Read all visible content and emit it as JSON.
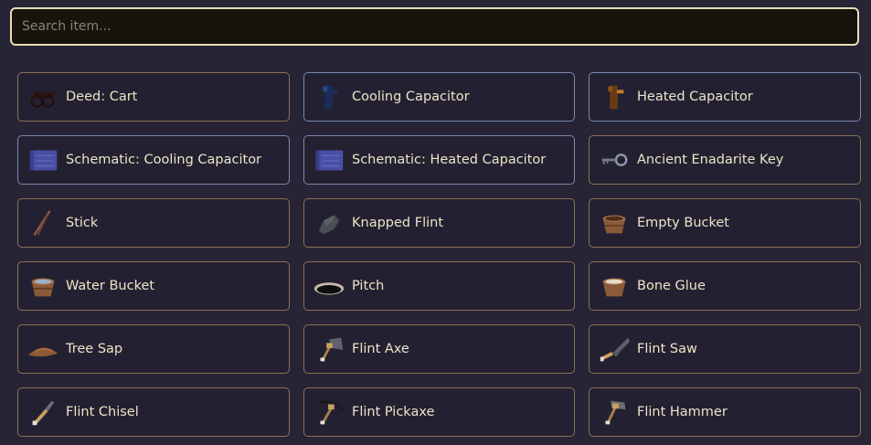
{
  "search": {
    "placeholder": "Search item...",
    "value": ""
  },
  "items": [
    {
      "label": "Deed: Cart",
      "icon": "cart-icon",
      "border": "#8a7253"
    },
    {
      "label": "Cooling Capacitor",
      "icon": "cooling-capacitor-icon",
      "border": "#7a89ad"
    },
    {
      "label": "Heated Capacitor",
      "icon": "heated-capacitor-icon",
      "border": "#7a89ad"
    },
    {
      "label": "Schematic: Cooling Capacitor",
      "icon": "schematic-icon",
      "border": "#7a89ad"
    },
    {
      "label": "Schematic: Heated Capacitor",
      "icon": "schematic-icon",
      "border": "#7a89ad"
    },
    {
      "label": "Ancient Enadarite Key",
      "icon": "key-icon",
      "border": "#8a7253"
    },
    {
      "label": "Stick",
      "icon": "stick-icon",
      "border": "#8a7253"
    },
    {
      "label": "Knapped Flint",
      "icon": "flint-icon",
      "border": "#8a7253"
    },
    {
      "label": "Empty Bucket",
      "icon": "empty-bucket-icon",
      "border": "#8a7253"
    },
    {
      "label": "Water Bucket",
      "icon": "water-bucket-icon",
      "border": "#8a7253"
    },
    {
      "label": "Pitch",
      "icon": "pitch-icon",
      "border": "#8a7253"
    },
    {
      "label": "Bone Glue",
      "icon": "bone-glue-icon",
      "border": "#8a7253"
    },
    {
      "label": "Tree Sap",
      "icon": "tree-sap-icon",
      "border": "#8a7253"
    },
    {
      "label": "Flint Axe",
      "icon": "axe-icon",
      "border": "#8a7253"
    },
    {
      "label": "Flint Saw",
      "icon": "saw-icon",
      "border": "#8a7253"
    },
    {
      "label": "Flint Chisel",
      "icon": "chisel-icon",
      "border": "#8a7253"
    },
    {
      "label": "Flint Pickaxe",
      "icon": "pickaxe-icon",
      "border": "#8a7253"
    },
    {
      "label": "Flint Hammer",
      "icon": "hammer-icon",
      "border": "#8a7253"
    }
  ]
}
